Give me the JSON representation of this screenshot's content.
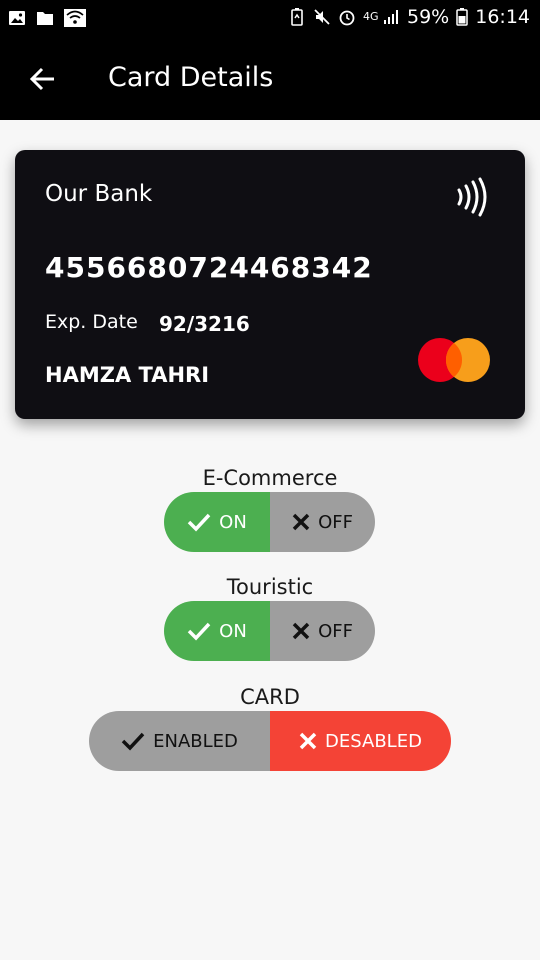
{
  "status_bar": {
    "battery": "59%",
    "time": "16:14",
    "network": "4G",
    "left_icons": [
      "image-icon",
      "folder-icon",
      "wifi-icon"
    ],
    "right_icons": [
      "battery-saver-icon",
      "mute-icon",
      "alarm-icon",
      "signal-icon",
      "battery-icon"
    ]
  },
  "app_bar": {
    "title": "Card Details",
    "back_icon": "arrow-left-icon"
  },
  "card": {
    "bank": "Our Bank",
    "number": "4556680724468342",
    "exp_label": "Exp. Date",
    "exp_value": "92/3216",
    "holder": "HAMZA TAHRI",
    "contactless_icon": "nfc-icon",
    "brand_icon": "mastercard-logo",
    "background": "#0f0e13"
  },
  "controls": {
    "ecommerce": {
      "label": "E-Commerce",
      "on": "ON",
      "off": "OFF",
      "selected": "ON"
    },
    "touristic": {
      "label": "Touristic",
      "on": "ON",
      "off": "OFF",
      "selected": "ON"
    },
    "card_state": {
      "label": "CARD",
      "enabled": "ENABLED",
      "disabled": "DESABLED",
      "selected": "DESABLED"
    }
  },
  "colors": {
    "on_green": "#4caf50",
    "inactive_gray": "#9e9e9e",
    "active_red": "#f44336",
    "mastercard_red": "#eb001b",
    "mastercard_orange": "#f79e1b"
  }
}
